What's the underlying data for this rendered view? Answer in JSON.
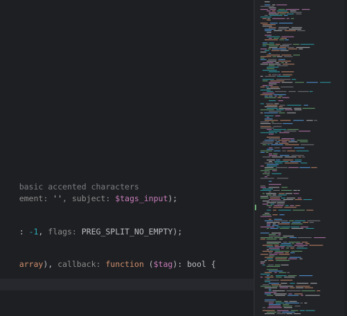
{
  "editor": {
    "lines": {
      "l1": {
        "comment": "basic accented characters"
      },
      "l2": {
        "a": "ement: ",
        "b": "''",
        "c": ", subject: ",
        "d": "$tags_input",
        "e": ");"
      },
      "l3": {
        "a": ": ",
        "b": "-1",
        "c": ", ",
        "d": "flags: ",
        "e": "PREG_SPLIT_NO_EMPTY",
        "f": ");"
      },
      "l4": {
        "a": "array",
        "b": "), ",
        "c": "callback: ",
        "d": "function",
        "e": " (",
        "f": "$tag",
        "g": "): ",
        "h": "bool",
        "i": " {"
      }
    }
  },
  "minimap": {
    "accent_colors": [
      "#cf8e6d",
      "#c77dbb",
      "#6aab73",
      "#bcbec4",
      "#2aacb8",
      "#56a8f5",
      "#7a7e85"
    ]
  }
}
